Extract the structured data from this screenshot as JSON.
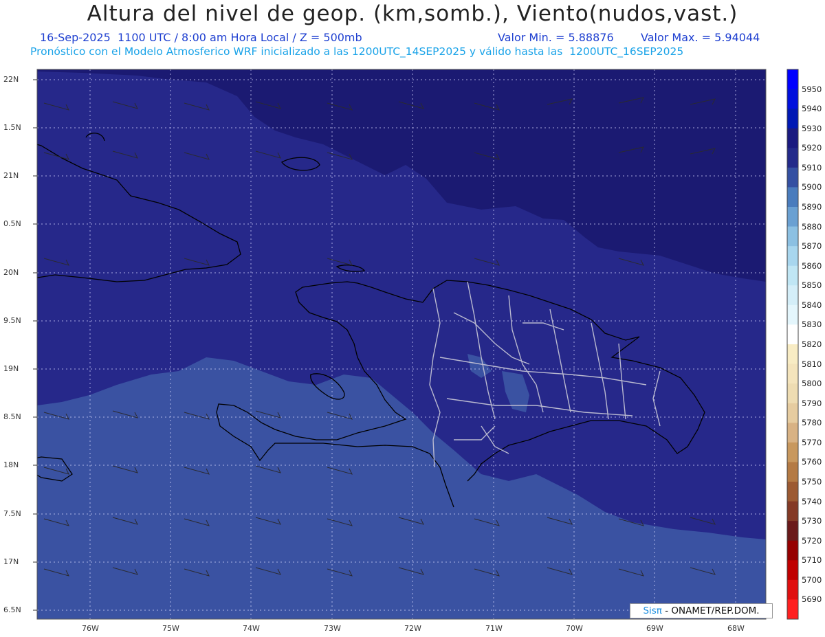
{
  "header": {
    "title": "Altura del nivel de geop. (km,somb.), Viento(nudos,vast.)",
    "date_time": "16-Sep-2025  1100 UTC / 8:00 am Hora Local / Z = 500mb",
    "min_value": "Valor Min. = 5.88876",
    "max_value": "Valor Max. = 5.94044",
    "model_info": "Pronóstico con el Modelo Atmosferico WRF inicializado a las 1200UTC_14SEP2025 y válido hasta las  1200UTC_16SEP2025"
  },
  "axes": {
    "y_labels": [
      "22N",
      "1.5N",
      "21N",
      "0.5N",
      "20N",
      "9.5N",
      "19N",
      "8.5N",
      "18N",
      "7.5N",
      "17N",
      "6.5N"
    ],
    "x_labels": [
      "76W",
      "75W",
      "74W",
      "73W",
      "72W",
      "71W",
      "70W",
      "69W",
      "68W"
    ]
  },
  "colorbar": {
    "labels": [
      "5950",
      "5940",
      "5930",
      "5920",
      "5910",
      "5900",
      "5890",
      "5880",
      "5870",
      "5860",
      "5850",
      "5840",
      "5830",
      "5820",
      "5810",
      "5800",
      "5790",
      "5780",
      "5770",
      "5760",
      "5750",
      "5740",
      "5730",
      "5720",
      "5710",
      "5700",
      "5690"
    ],
    "colors": [
      "#0000ff",
      "#0010dd",
      "#0018b4",
      "#1a1a80",
      "#232a8a",
      "#3450a2",
      "#4a7cbd",
      "#6aa0d2",
      "#8cc0e2",
      "#a8d6ee",
      "#c0e6f4",
      "#d4eef8",
      "#e4f6fc",
      "#ffffff",
      "#f8ecc4",
      "#f4e4bc",
      "#eedcb2",
      "#e6cca0",
      "#d8b284",
      "#c8985e",
      "#b47a44",
      "#9c5a32",
      "#843a26",
      "#6a1a1a",
      "#960000",
      "#c00000",
      "#e01010",
      "#ff2020"
    ]
  },
  "credit": {
    "brand": "Sisπ",
    "text": " - ONAMET/REP.DOM."
  }
}
